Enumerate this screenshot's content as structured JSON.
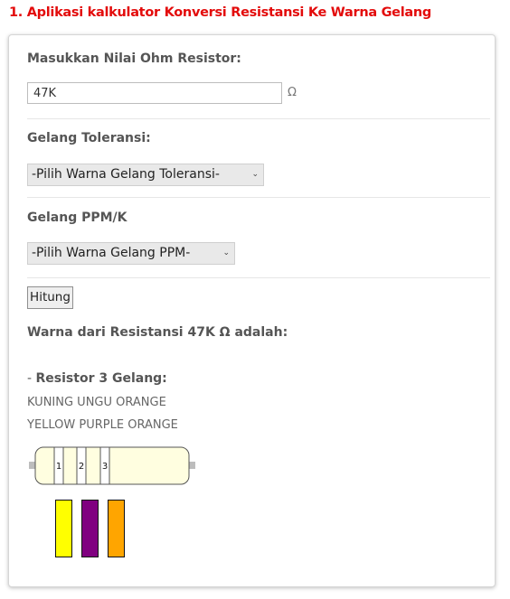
{
  "page": {
    "title": "1. Aplikasi kalkulator Konversi Resistansi Ke Warna Gelang"
  },
  "form": {
    "ohm_label": "Masukkan Nilai Ohm Resistor:",
    "ohm_value": "47K",
    "ohm_unit": "Ω",
    "tolerance_label": "Gelang Toleransi:",
    "tolerance_selected": "-Pilih Warna Gelang Toleransi-",
    "ppm_label": "Gelang PPM/K",
    "ppm_selected": "-Pilih Warna Gelang PPM-",
    "calculate_button": "Hitung"
  },
  "result": {
    "heading": "Warna dari Resistansi 47K Ω adalah:",
    "section_dash": "- ",
    "section_title": "Resistor 3 Gelang:",
    "colors_id": "KUNING UNGU ORANGE",
    "colors_en": "YELLOW PURPLE ORANGE",
    "band_numbers": [
      "1",
      "2",
      "3"
    ],
    "swatches": [
      {
        "name": "yellow",
        "color": "#ffff00"
      },
      {
        "name": "purple",
        "color": "#800080"
      },
      {
        "name": "orange",
        "color": "#ffa500"
      }
    ]
  }
}
